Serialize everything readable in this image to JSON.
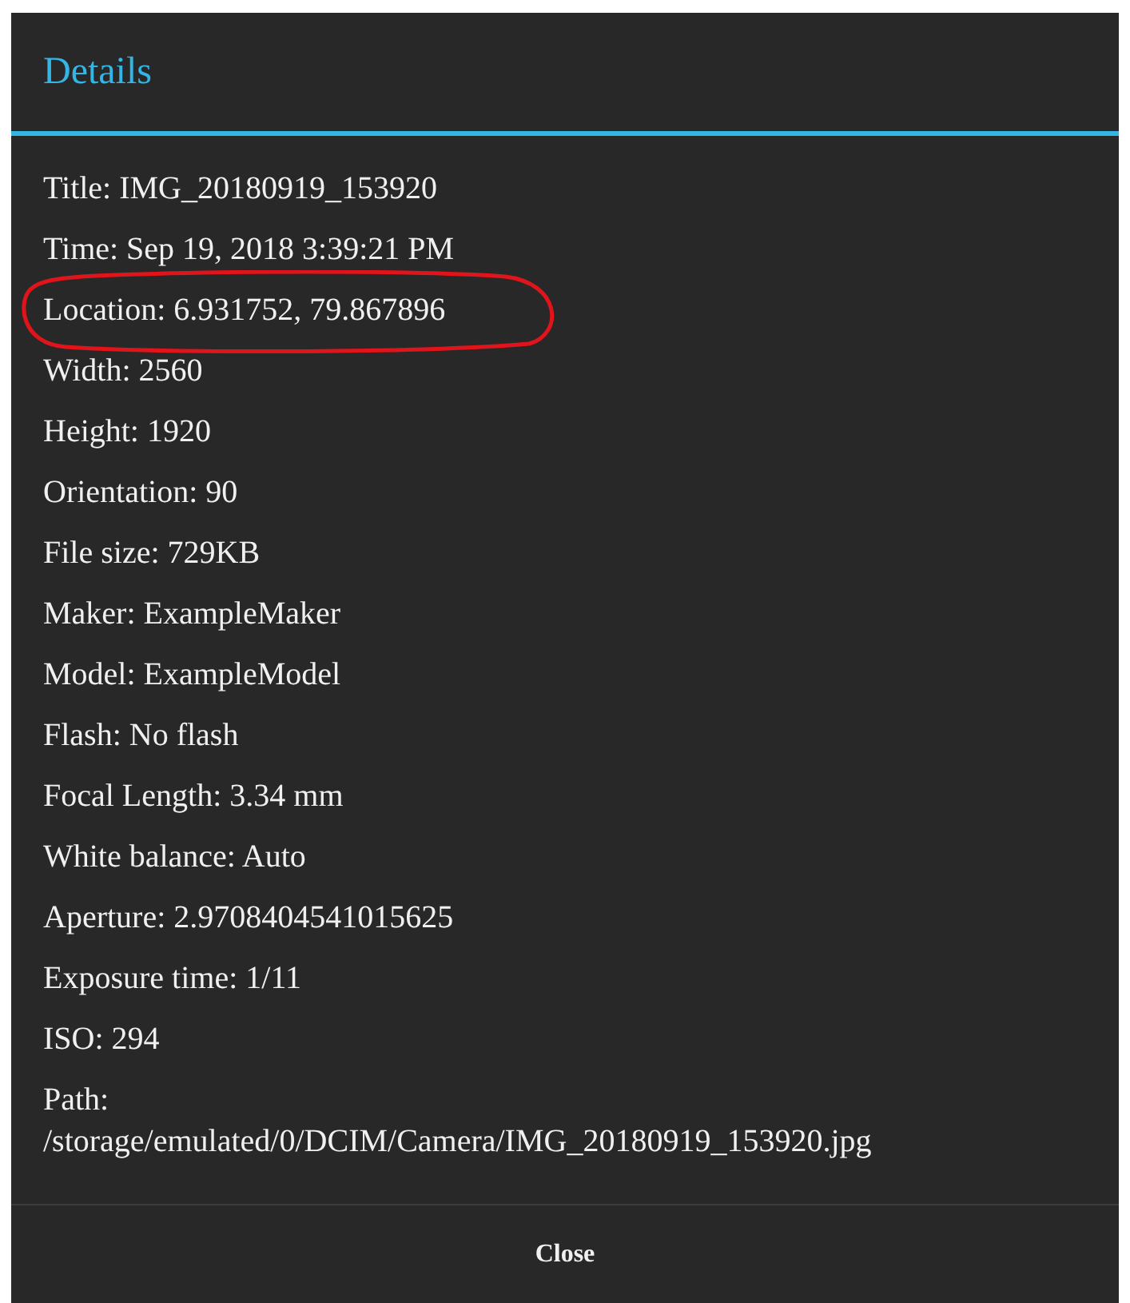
{
  "dialog": {
    "title": "Details",
    "rows": [
      {
        "text": "Title: IMG_20180919_153920",
        "kind": "inline",
        "circled": false
      },
      {
        "text": "Time: Sep 19, 2018 3:39:21 PM",
        "kind": "inline",
        "circled": false
      },
      {
        "text": "Location: 6.931752, 79.867896",
        "kind": "inline",
        "circled": true
      },
      {
        "text": "Width: 2560",
        "kind": "inline",
        "circled": false
      },
      {
        "text": "Height: 1920",
        "kind": "inline",
        "circled": false
      },
      {
        "text": "Orientation: 90",
        "kind": "inline",
        "circled": false
      },
      {
        "text": "File size: 729KB",
        "kind": "inline",
        "circled": false
      },
      {
        "text": "Maker: ExampleMaker",
        "kind": "inline",
        "circled": false
      },
      {
        "text": "Model: ExampleModel",
        "kind": "inline",
        "circled": false
      },
      {
        "text": "Flash: No flash",
        "kind": "inline",
        "circled": false
      },
      {
        "text": "Focal Length: 3.34 mm",
        "kind": "inline",
        "circled": false
      },
      {
        "text": "White balance: Auto",
        "kind": "inline",
        "circled": false
      },
      {
        "text": "Aperture: 2.9708404541015625",
        "kind": "inline",
        "circled": false
      },
      {
        "text": "Exposure time: 1/11",
        "kind": "inline",
        "circled": false
      },
      {
        "text": "ISO: 294",
        "kind": "inline",
        "circled": false
      },
      {
        "text": "Path:",
        "value": "/storage/emulated/0/DCIM/Camera/IMG_20180919_153920.jpg",
        "kind": "stacked",
        "circled": false
      }
    ],
    "button": "Close"
  }
}
